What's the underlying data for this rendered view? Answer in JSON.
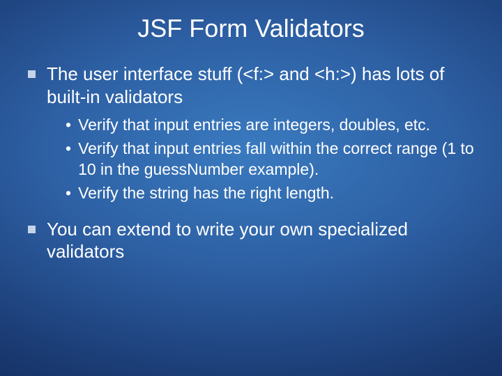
{
  "title": "JSF Form Validators",
  "bullets": {
    "b1": "The user interface stuff (<f:> and <h:>) has lots of built-in validators",
    "b1_sub": {
      "s1": "Verify that input entries are integers, doubles, etc.",
      "s2": "Verify that input entries fall within the correct range (1 to 10 in the guessNumber example).",
      "s3": "Verify the string has the right length."
    },
    "b2": "You can extend to write your own specialized validators"
  },
  "sub_marker": "•"
}
